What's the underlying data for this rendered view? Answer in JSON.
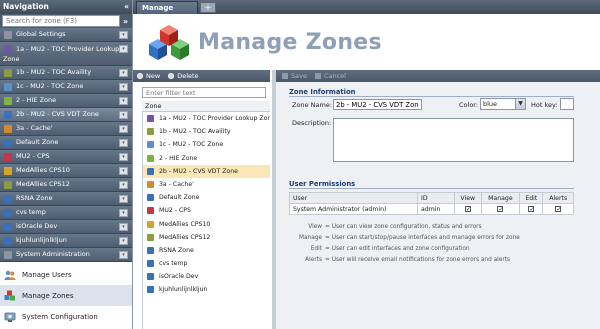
{
  "nav": {
    "title": "Navigation",
    "collapse": "«",
    "search_placeholder": "Search for zone (F3)",
    "search_go": "»",
    "zones": [
      {
        "label": "Global Settings",
        "color": "#8a96a4",
        "icon": "globe-icon"
      },
      {
        "label": "1a - MU2 - TOC Provider Lookup Zone",
        "color": "#6f56a6",
        "icon": "zone-icon",
        "tall": true
      },
      {
        "label": "1b - MU2 - TOC Availity",
        "color": "#8b9e3e",
        "icon": "zone-icon"
      },
      {
        "label": "1c - MU2 - TOC Zone",
        "color": "#5d8fc9",
        "icon": "zone-icon"
      },
      {
        "label": "2 - HIE Zone",
        "color": "#7cb342",
        "icon": "zone-icon"
      },
      {
        "label": "2b - MU2 - CVS VDT Zone",
        "color": "#3b6fb6",
        "icon": "zone-icon",
        "selected": true
      },
      {
        "label": "3a - Cache'",
        "color": "#d58a2b",
        "icon": "zone-icon"
      },
      {
        "label": "Default Zone",
        "color": "#3b6fb6",
        "icon": "zone-icon"
      },
      {
        "label": "MU2 - CPS",
        "color": "#c7344a",
        "icon": "zone-icon"
      },
      {
        "label": "MedAllies CPS10",
        "color": "#d3a42a",
        "icon": "zone-icon"
      },
      {
        "label": "MedAllies CPS12",
        "color": "#8b9e3e",
        "icon": "zone-icon"
      },
      {
        "label": "RSNA Zone",
        "color": "#3b6fb6",
        "icon": "zone-icon"
      },
      {
        "label": "cvs temp",
        "color": "#3b6fb6",
        "icon": "zone-icon"
      },
      {
        "label": "isOracle Dev",
        "color": "#3b6fb6",
        "icon": "zone-icon"
      },
      {
        "label": "kjuhlunlijnlkljun",
        "color": "#3b6fb6",
        "icon": "zone-icon"
      },
      {
        "label": "System Administration",
        "color": "#8a96a4",
        "icon": "admin-icon"
      }
    ],
    "links": [
      {
        "label": "Manage Users",
        "icon": "users-icon"
      },
      {
        "label": "Manage Zones",
        "icon": "cubes-icon",
        "active": true
      },
      {
        "label": "System Configuration",
        "icon": "config-icon"
      }
    ]
  },
  "tabs": {
    "active": "Manage Zones",
    "add": "+"
  },
  "banner": {
    "title": "Manage Zones"
  },
  "list": {
    "new_label": "New",
    "delete_label": "Delete",
    "filter_placeholder": "Enter filter text",
    "column": "Zone",
    "rows": [
      {
        "label": "1a - MU2 - TOC Provider Lookup Zone",
        "color": "#6f56a6"
      },
      {
        "label": "1b - MU2 - TOC Availity",
        "color": "#8b9e3e"
      },
      {
        "label": "1c - MU2 - TOC Zone",
        "color": "#5d8fc9"
      },
      {
        "label": "2 - HIE Zone",
        "color": "#7cb342"
      },
      {
        "label": "2b - MU2 - CVS VDT Zone",
        "color": "#3b6fb6",
        "selected": true
      },
      {
        "label": "3a - Cache'",
        "color": "#d58a2b"
      },
      {
        "label": "Default Zone",
        "color": "#3b6fb6"
      },
      {
        "label": "MU2 - CPS",
        "color": "#c7344a"
      },
      {
        "label": "MedAllies CPS10",
        "color": "#d3a42a"
      },
      {
        "label": "MedAllies CPS12",
        "color": "#8b9e3e"
      },
      {
        "label": "RSNA Zone",
        "color": "#3b6fb6"
      },
      {
        "label": "cvs temp",
        "color": "#3b6fb6"
      },
      {
        "label": "isOracle Dev",
        "color": "#3b6fb6"
      },
      {
        "label": "kjuhlunlijnlkljun",
        "color": "#3b6fb6"
      }
    ]
  },
  "detail": {
    "save_label": "Save",
    "cancel_label": "Cancel",
    "zone_info_title": "Zone Information",
    "zone_name_label": "Zone Name:",
    "zone_name_value": "2b - MU2 - CVS VDT Zone",
    "color_label": "Color:",
    "color_value": "blue",
    "hotkey_label": "Hot key:",
    "description_label": "Description:",
    "permissions_title": "User Permissions",
    "perm_headers": [
      "User",
      "ID",
      "View",
      "Manage",
      "Edit",
      "Alerts"
    ],
    "perm_rows": [
      {
        "user": "System Administrator (admin)",
        "id": "admin",
        "view": true,
        "manage": true,
        "edit": true,
        "alerts": true
      }
    ],
    "legend": [
      {
        "key": "View",
        "text": "= User can view zone configuration, status and errors"
      },
      {
        "key": "Manage",
        "text": "= User can start/stop/pause interfaces and manage errors for zone"
      },
      {
        "key": "Edit",
        "text": "= User can edit interfaces and zone configuration"
      },
      {
        "key": "Alerts",
        "text": "= User will receive email notifications for zone errors and alerts"
      }
    ]
  }
}
